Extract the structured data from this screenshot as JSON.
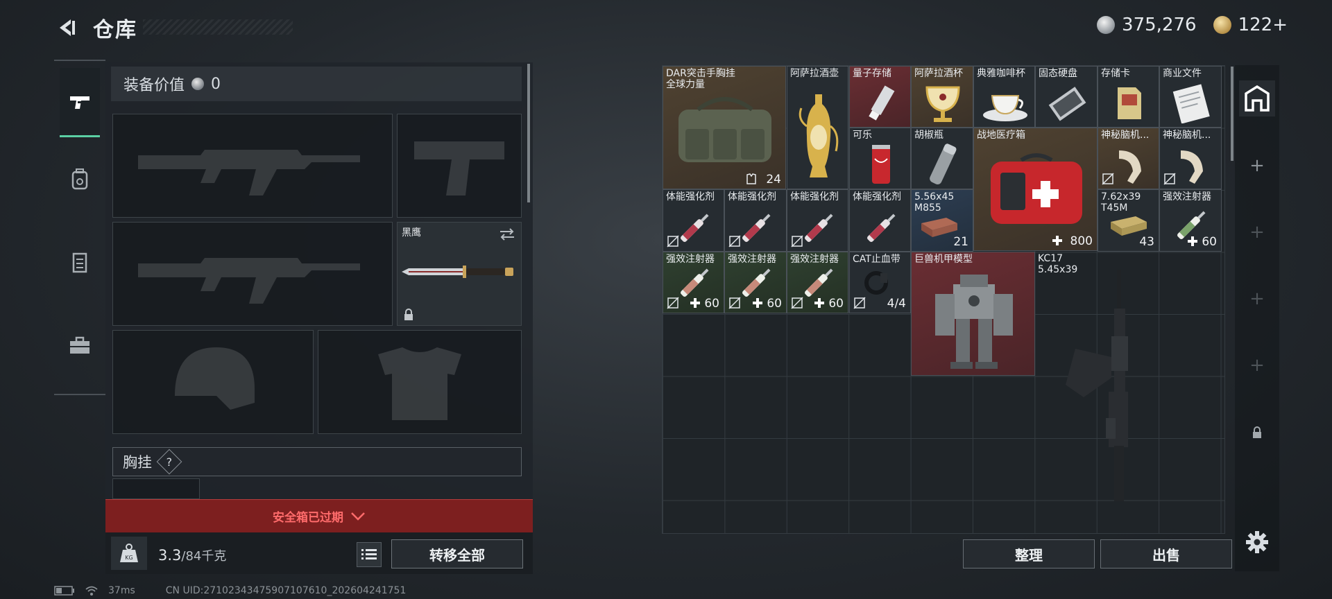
{
  "header": {
    "title": "仓库",
    "currency": [
      {
        "icon": "silver-coin-icon",
        "value": "375,276"
      },
      {
        "icon": "gold-coin-icon",
        "value": "122+"
      }
    ]
  },
  "tabs": [
    {
      "icon": "pistol-icon",
      "active": true
    },
    {
      "icon": "backpack-icon",
      "active": false
    },
    {
      "icon": "vest-icon",
      "active": false
    },
    {
      "icon": "toolbox-icon",
      "active": false
    }
  ],
  "loadout": {
    "equip_value_label": "装备价值",
    "equip_value": "0",
    "melee_name": "黑鹰",
    "chest_rig_label": "胸挂",
    "chest_rig_help": "?",
    "safe_box_status": "安全箱已过期",
    "weight": "3.3",
    "weight_capacity": "/84千克",
    "transfer_all": "转移全部"
  },
  "stash": {
    "items": [
      {
        "id": "dar-rig",
        "name": "DAR突击手胸挂\n全球力量",
        "count": "24",
        "count_icon": "vest-small-icon",
        "rarity": "gold"
      },
      {
        "id": "ewer",
        "name": "阿萨拉酒壶",
        "count": "",
        "rarity": "dark"
      },
      {
        "id": "quantum",
        "name": "量子存储",
        "count": "",
        "rarity": "red"
      },
      {
        "id": "wine-cup",
        "name": "阿萨拉酒杯",
        "count": "",
        "rarity": "gold"
      },
      {
        "id": "coffee",
        "name": "典雅咖啡杯",
        "count": "",
        "rarity": "dark"
      },
      {
        "id": "ssd",
        "name": "固态硬盘",
        "count": "",
        "rarity": "dark"
      },
      {
        "id": "card",
        "name": "存储卡",
        "count": "",
        "rarity": "dark"
      },
      {
        "id": "docs",
        "name": "商业文件",
        "count": "",
        "rarity": "dark"
      },
      {
        "id": "cola",
        "name": "可乐",
        "count": "",
        "rarity": "dark"
      },
      {
        "id": "pepper",
        "name": "胡椒瓶",
        "count": "",
        "rarity": "dark"
      },
      {
        "id": "medkit",
        "name": "战地医疗箱",
        "count": "800",
        "rarity": "gold"
      },
      {
        "id": "brain1",
        "name": "神秘脑机...",
        "count": "",
        "rarity": "gold"
      },
      {
        "id": "brain2",
        "name": "神秘脑机...",
        "count": "",
        "rarity": "dark"
      },
      {
        "id": "stim1",
        "name": "体能强化剂",
        "count": "",
        "rarity": "dark"
      },
      {
        "id": "stim2",
        "name": "体能强化剂",
        "count": "",
        "rarity": "dark"
      },
      {
        "id": "stim3",
        "name": "体能强化剂",
        "count": "",
        "rarity": "dark"
      },
      {
        "id": "stim4",
        "name": "体能强化剂",
        "count": "",
        "rarity": "dark"
      },
      {
        "id": "ammo556",
        "name": "5.56x45\nM855",
        "count": "21",
        "rarity": "blue"
      },
      {
        "id": "ammo762",
        "name": "7.62x39\nT45M",
        "count": "43",
        "rarity": "dark"
      },
      {
        "id": "inj1",
        "name": "强效注射器",
        "count": "60",
        "rarity": "dark"
      },
      {
        "id": "inj2",
        "name": "强效注射器",
        "count": "60",
        "rarity": "green"
      },
      {
        "id": "inj3",
        "name": "强效注射器",
        "count": "60",
        "rarity": "green"
      },
      {
        "id": "inj4",
        "name": "强效注射器",
        "count": "60",
        "rarity": "green"
      },
      {
        "id": "tourniquet",
        "name": "CAT止血带",
        "count": "4/4",
        "rarity": "dark"
      },
      {
        "id": "mech",
        "name": "巨兽机甲模型",
        "count": "",
        "rarity": "red"
      },
      {
        "id": "kc17",
        "name": "KC17\n5.45x39",
        "count": "",
        "rarity": "none"
      }
    ],
    "sort_label": "整理",
    "sell_label": "出售"
  },
  "rail": {
    "icons": [
      "stash-home-icon",
      "plus-icon",
      "plus-icon",
      "plus-icon",
      "plus-icon",
      "lock-icon"
    ]
  },
  "status_bar": {
    "ping": "37ms",
    "uid": "CN UID:27102343475907107610_202604241751"
  },
  "colors": {
    "accent": "#5bd0a4",
    "danger_bg": "#7d1f1f",
    "danger_text": "#ff6b6b",
    "rarity_gold": "#4f4231",
    "rarity_red": "#6a2e33"
  }
}
